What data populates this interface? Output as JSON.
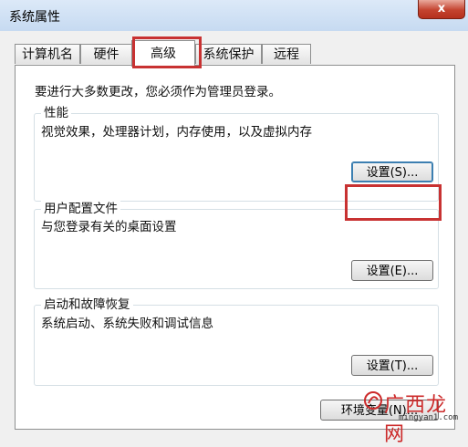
{
  "window": {
    "title": "系统属性",
    "close_label": "x"
  },
  "tabs": [
    {
      "label": "计算机名",
      "active": false
    },
    {
      "label": "硬件",
      "active": false
    },
    {
      "label": "高级",
      "active": true
    },
    {
      "label": "系统保护",
      "active": false
    },
    {
      "label": "远程",
      "active": false
    }
  ],
  "notice": "要进行大多数更改，您必须作为管理员登录。",
  "groups": {
    "performance": {
      "title": "性能",
      "desc": "视觉效果，处理器计划，内存使用，以及虚拟内存",
      "button": "设置(S)..."
    },
    "profiles": {
      "title": "用户配置文件",
      "desc": "与您登录有关的桌面设置",
      "button": "设置(E)..."
    },
    "startup": {
      "title": "启动和故障恢复",
      "desc": "系统启动、系统失败和调试信息",
      "button": "设置(T)..."
    }
  },
  "footer": {
    "env_button": "环境变量(N)..."
  },
  "watermark": {
    "text": "广西龙网",
    "url": "mingyan1.com"
  },
  "colors": {
    "highlight": "#c83232",
    "close": "#c4432f",
    "watermark": "#cc2a2a"
  }
}
